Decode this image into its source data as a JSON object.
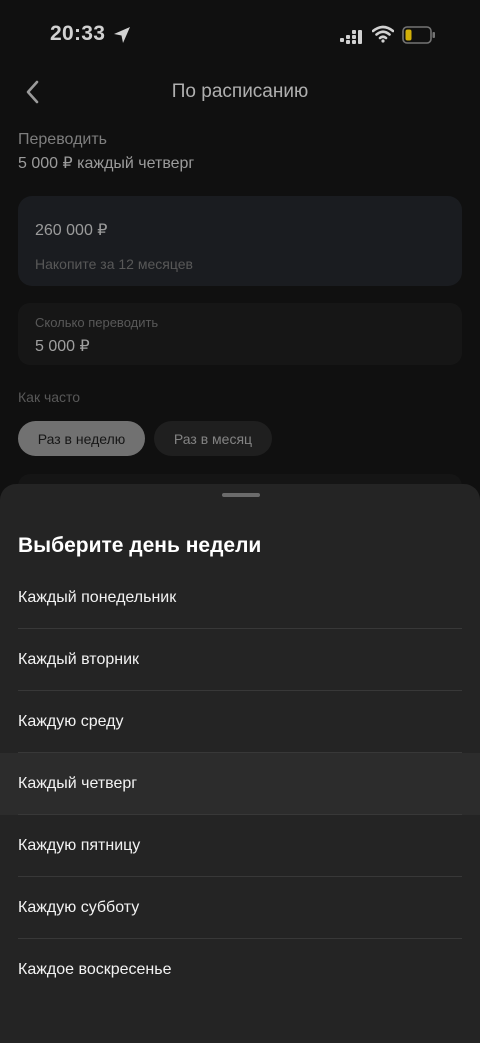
{
  "status_bar": {
    "time": "20:33"
  },
  "header": {
    "title": "По расписанию"
  },
  "schedule": {
    "caption": "Переводить",
    "summary": "5 000 ₽ каждый четверг"
  },
  "goal": {
    "amount": "260 000 ₽",
    "hint": "Накопите за 12 месяцев"
  },
  "amount_field": {
    "label": "Сколько переводить",
    "value": "5 000 ₽"
  },
  "frequency": {
    "label": "Как часто",
    "options": [
      "Раз в неделю",
      "Раз в месяц"
    ],
    "selected": "Раз в неделю"
  },
  "sheet": {
    "title": "Выберите день недели",
    "options": [
      "Каждый понедельник",
      "Каждый вторник",
      "Каждую среду",
      "Каждый четверг",
      "Каждую пятницу",
      "Каждую субботу",
      "Каждое воскресенье"
    ],
    "selected_index": 3
  },
  "colors": {
    "sheet_background": "#242424",
    "selected_row": "#2c2c2c",
    "selected_chip": "#8a8a8a",
    "battery_level": "#ffd60a"
  }
}
